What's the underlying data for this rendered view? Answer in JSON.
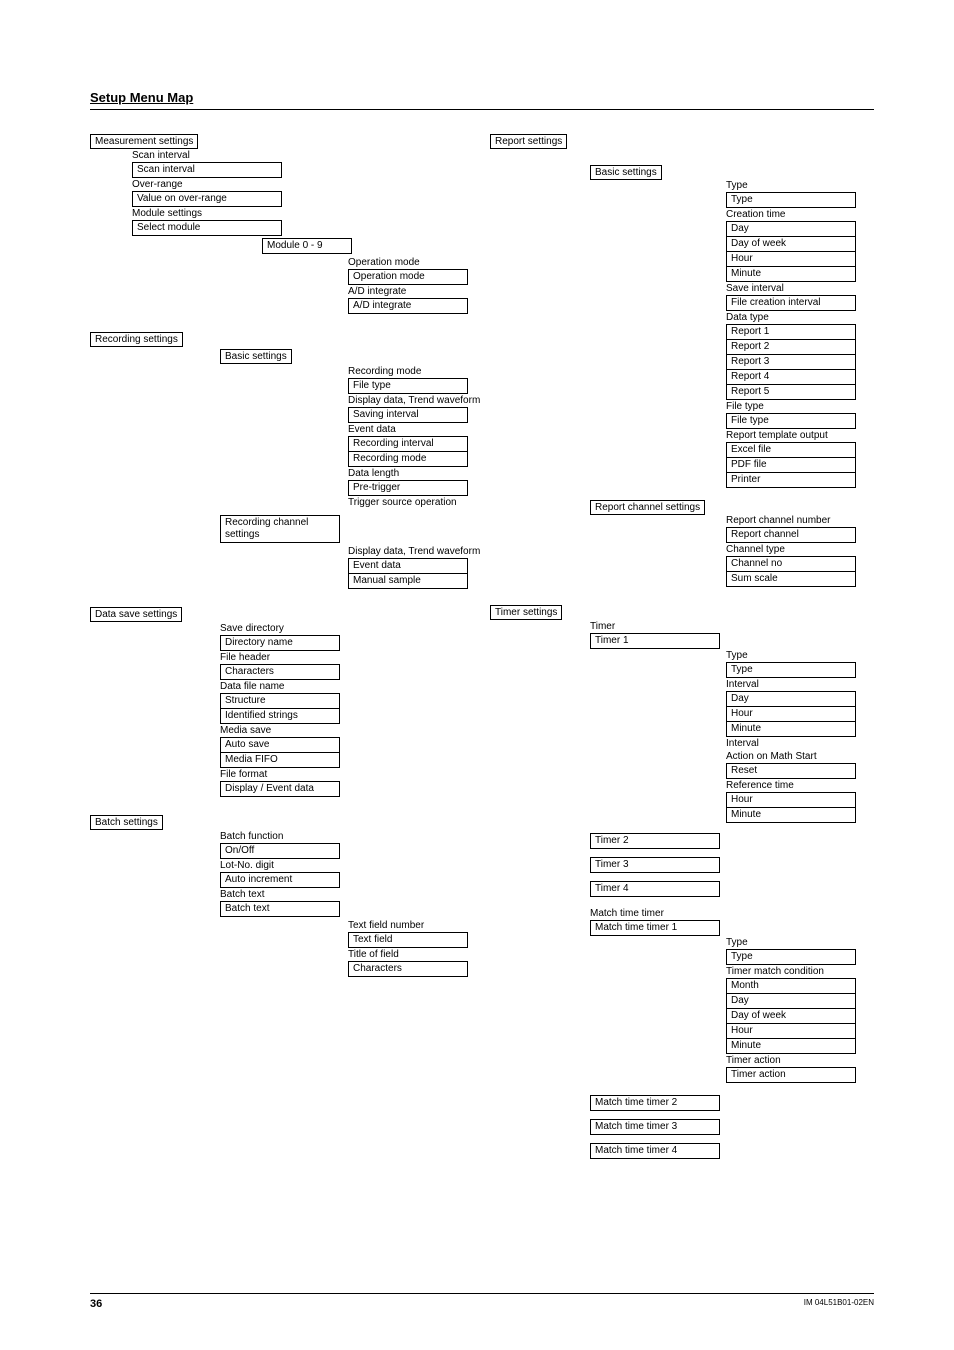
{
  "title": "Setup Menu Map",
  "left": {
    "measurement": {
      "head": "Measurement settings",
      "scan_interval_lbl": "Scan interval",
      "scan_interval_box": "Scan interval",
      "over_range_lbl": "Over-range",
      "value_over_range_box": "Value on over-range",
      "module_settings_lbl": "Module settings",
      "select_module_box": "Select module",
      "module_0_9": "Module 0 - 9",
      "op_mode_lbl": "Operation mode",
      "op_mode_box": "Operation mode",
      "ad_lbl": "A/D integrate",
      "ad_box": "A/D integrate"
    },
    "recording": {
      "head": "Recording settings",
      "basic_box": "Basic settings",
      "items": {
        "rec_mode_lbl": "Recording mode",
        "file_type_box": "File type",
        "disp_trend_lbl": "Display data, Trend waveform",
        "save_int_box": "Saving interval",
        "event_lbl": "Event data",
        "rec_int_box": "Recording interval",
        "rec_mode_box": "Recording mode",
        "data_len_lbl": "Data length",
        "pre_trg_box": "Pre-trigger",
        "trg_src_lbl": "Trigger source operation"
      },
      "rec_ch_box": "Recording channel settings",
      "ch_items": {
        "disp_trend_lbl": "Display data, Trend waveform",
        "event_box": "Event data",
        "manual_box": "Manual sample"
      }
    },
    "datasave": {
      "head": "Data save settings",
      "save_dir_lbl": "Save directory",
      "dir_name_box": "Directory name",
      "file_header_lbl": "File header",
      "characters_box": "Characters",
      "data_file_lbl": "Data file name",
      "structure_box": "Structure",
      "ident_box": "Identified strings",
      "media_save_lbl": "Media save",
      "auto_save_box": "Auto save",
      "media_fifo_box": "Media FIFO",
      "file_format_lbl": "File format",
      "display_event_box": "Display / Event data"
    },
    "batch": {
      "head": "Batch settings",
      "batch_fn_lbl": "Batch function",
      "onoff_box": "On/Off",
      "lot_lbl": "Lot-No. digit",
      "auto_inc_box": "Auto increment",
      "batch_text_lbl": "Batch text",
      "batch_text_box": "Batch text",
      "txt_num_lbl": "Text field number",
      "txt_field_box": "Text field",
      "title_lbl": "Title of field",
      "chars_box": "Characters"
    }
  },
  "right": {
    "report": {
      "head": "Report settings",
      "basic_box": "Basic settings",
      "type_lbl": "Type",
      "type_box": "Type",
      "creation_lbl": "Creation time",
      "day_box": "Day",
      "dow_box": "Day of week",
      "hour_box": "Hour",
      "minute_box": "Minute",
      "save_int_lbl": "Save interval",
      "file_create_box": "File creation interval",
      "data_type_lbl": "Data type",
      "r1": "Report 1",
      "r2": "Report 2",
      "r3": "Report 3",
      "r4": "Report 4",
      "r5": "Report 5",
      "ft_lbl": "File type",
      "ft_box": "File type",
      "rto_lbl": "Report template output",
      "excel_box": "Excel file",
      "pdf_box": "PDF file",
      "printer_box": "Printer",
      "rch_box": "Report channel settings",
      "rch_num_lbl": "Report channel number",
      "rch_box2": "Report channel",
      "ch_type_lbl": "Channel type",
      "ch_no_box": "Channel no",
      "sum_box": "Sum scale"
    },
    "timer": {
      "head": "Timer settings",
      "timer_lbl": "Timer",
      "t1": "Timer 1",
      "type_lbl": "Type",
      "type_box": "Type",
      "interval_lbl": "Interval",
      "day_box": "Day",
      "hour_box": "Hour",
      "minute_box": "Minute",
      "interval_lbl2": "Interval",
      "action_lbl": "Action on Math Start",
      "reset_box": "Reset",
      "ref_time_lbl": "Reference time",
      "hour_box2": "Hour",
      "minute_box2": "Minute",
      "t2": "Timer 2",
      "t3": "Timer 3",
      "t4": "Timer 4",
      "mtt_lbl": "Match time timer",
      "mtt1": "Match time timer 1",
      "m_type_lbl": "Type",
      "m_type_box": "Type",
      "m_cond_lbl": "Timer match condition",
      "m_month_box": "Month",
      "m_day_box": "Day",
      "m_dow_box": "Day of week",
      "m_hour_box": "Hour",
      "m_minute_box": "Minute",
      "m_action_lbl": "Timer action",
      "m_action_box": "Timer action",
      "mtt2": "Match time timer 2",
      "mtt3": "Match time timer 3",
      "mtt4": "Match time timer 4"
    }
  },
  "footer": {
    "page": "36",
    "doc": "IM 04L51B01-02EN"
  }
}
